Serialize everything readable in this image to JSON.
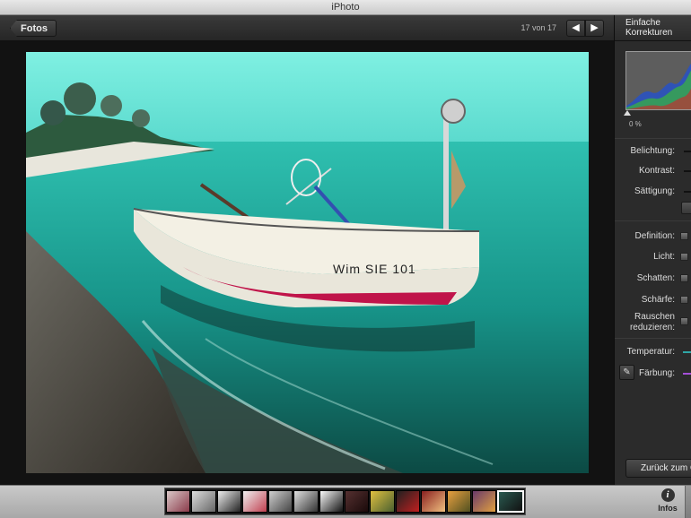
{
  "window": {
    "title": "iPhoto"
  },
  "toolbar": {
    "back_label": "Fotos",
    "counter": "17 von 17",
    "prev_glyph": "◀",
    "next_glyph": "▶"
  },
  "photo": {
    "hull_text": "Wim   SIE 101"
  },
  "panel": {
    "tab_label_line1": "Einfache",
    "tab_label_line2": "Korrekturen",
    "histogram_percent": "0 %",
    "controls": [
      {
        "label": "Belichtung:"
      },
      {
        "label": "Kontrast:"
      },
      {
        "label": "Sättigung:"
      },
      {
        "label": "Definition:"
      },
      {
        "label": "Licht:"
      },
      {
        "label": "Schatten:"
      },
      {
        "label": "Schärfe:"
      },
      {
        "label": "Rauschen",
        "label2": "reduzieren:"
      },
      {
        "label": "Temperatur:"
      },
      {
        "label": "Färbung:"
      }
    ],
    "revert_label": "Zurück zum Original"
  },
  "bottom": {
    "info_label": "Infos",
    "filmstrip_count": 14,
    "selected_index": 13
  },
  "colors": {
    "sky": "#5fe0d0",
    "sea": "#1fa89a",
    "temperature_bar": "#2fa6a6",
    "tint_bar": "#a44fd8"
  }
}
